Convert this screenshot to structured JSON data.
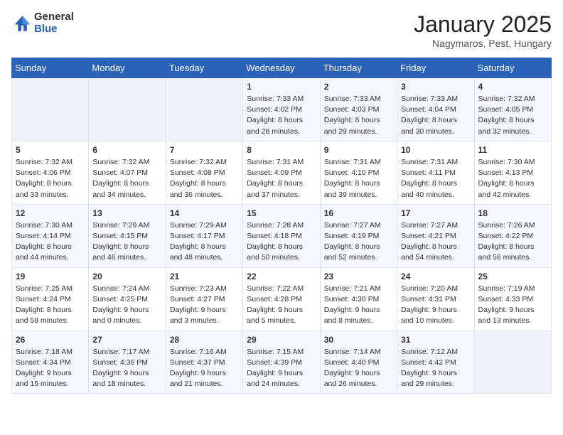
{
  "logo": {
    "general": "General",
    "blue": "Blue"
  },
  "title": "January 2025",
  "location": "Nagymaros, Pest, Hungary",
  "days_of_week": [
    "Sunday",
    "Monday",
    "Tuesday",
    "Wednesday",
    "Thursday",
    "Friday",
    "Saturday"
  ],
  "weeks": [
    [
      {
        "day": "",
        "info": ""
      },
      {
        "day": "",
        "info": ""
      },
      {
        "day": "",
        "info": ""
      },
      {
        "day": "1",
        "info": "Sunrise: 7:33 AM\nSunset: 4:02 PM\nDaylight: 8 hours and 28 minutes."
      },
      {
        "day": "2",
        "info": "Sunrise: 7:33 AM\nSunset: 4:03 PM\nDaylight: 8 hours and 29 minutes."
      },
      {
        "day": "3",
        "info": "Sunrise: 7:33 AM\nSunset: 4:04 PM\nDaylight: 8 hours and 30 minutes."
      },
      {
        "day": "4",
        "info": "Sunrise: 7:32 AM\nSunset: 4:05 PM\nDaylight: 8 hours and 32 minutes."
      }
    ],
    [
      {
        "day": "5",
        "info": "Sunrise: 7:32 AM\nSunset: 4:06 PM\nDaylight: 8 hours and 33 minutes."
      },
      {
        "day": "6",
        "info": "Sunrise: 7:32 AM\nSunset: 4:07 PM\nDaylight: 8 hours and 34 minutes."
      },
      {
        "day": "7",
        "info": "Sunrise: 7:32 AM\nSunset: 4:08 PM\nDaylight: 8 hours and 36 minutes."
      },
      {
        "day": "8",
        "info": "Sunrise: 7:31 AM\nSunset: 4:09 PM\nDaylight: 8 hours and 37 minutes."
      },
      {
        "day": "9",
        "info": "Sunrise: 7:31 AM\nSunset: 4:10 PM\nDaylight: 8 hours and 39 minutes."
      },
      {
        "day": "10",
        "info": "Sunrise: 7:31 AM\nSunset: 4:11 PM\nDaylight: 8 hours and 40 minutes."
      },
      {
        "day": "11",
        "info": "Sunrise: 7:30 AM\nSunset: 4:13 PM\nDaylight: 8 hours and 42 minutes."
      }
    ],
    [
      {
        "day": "12",
        "info": "Sunrise: 7:30 AM\nSunset: 4:14 PM\nDaylight: 8 hours and 44 minutes."
      },
      {
        "day": "13",
        "info": "Sunrise: 7:29 AM\nSunset: 4:15 PM\nDaylight: 8 hours and 46 minutes."
      },
      {
        "day": "14",
        "info": "Sunrise: 7:29 AM\nSunset: 4:17 PM\nDaylight: 8 hours and 48 minutes."
      },
      {
        "day": "15",
        "info": "Sunrise: 7:28 AM\nSunset: 4:18 PM\nDaylight: 8 hours and 50 minutes."
      },
      {
        "day": "16",
        "info": "Sunrise: 7:27 AM\nSunset: 4:19 PM\nDaylight: 8 hours and 52 minutes."
      },
      {
        "day": "17",
        "info": "Sunrise: 7:27 AM\nSunset: 4:21 PM\nDaylight: 8 hours and 54 minutes."
      },
      {
        "day": "18",
        "info": "Sunrise: 7:26 AM\nSunset: 4:22 PM\nDaylight: 8 hours and 56 minutes."
      }
    ],
    [
      {
        "day": "19",
        "info": "Sunrise: 7:25 AM\nSunset: 4:24 PM\nDaylight: 8 hours and 58 minutes."
      },
      {
        "day": "20",
        "info": "Sunrise: 7:24 AM\nSunset: 4:25 PM\nDaylight: 9 hours and 0 minutes."
      },
      {
        "day": "21",
        "info": "Sunrise: 7:23 AM\nSunset: 4:27 PM\nDaylight: 9 hours and 3 minutes."
      },
      {
        "day": "22",
        "info": "Sunrise: 7:22 AM\nSunset: 4:28 PM\nDaylight: 9 hours and 5 minutes."
      },
      {
        "day": "23",
        "info": "Sunrise: 7:21 AM\nSunset: 4:30 PM\nDaylight: 9 hours and 8 minutes."
      },
      {
        "day": "24",
        "info": "Sunrise: 7:20 AM\nSunset: 4:31 PM\nDaylight: 9 hours and 10 minutes."
      },
      {
        "day": "25",
        "info": "Sunrise: 7:19 AM\nSunset: 4:33 PM\nDaylight: 9 hours and 13 minutes."
      }
    ],
    [
      {
        "day": "26",
        "info": "Sunrise: 7:18 AM\nSunset: 4:34 PM\nDaylight: 9 hours and 15 minutes."
      },
      {
        "day": "27",
        "info": "Sunrise: 7:17 AM\nSunset: 4:36 PM\nDaylight: 9 hours and 18 minutes."
      },
      {
        "day": "28",
        "info": "Sunrise: 7:16 AM\nSunset: 4:37 PM\nDaylight: 9 hours and 21 minutes."
      },
      {
        "day": "29",
        "info": "Sunrise: 7:15 AM\nSunset: 4:39 PM\nDaylight: 9 hours and 24 minutes."
      },
      {
        "day": "30",
        "info": "Sunrise: 7:14 AM\nSunset: 4:40 PM\nDaylight: 9 hours and 26 minutes."
      },
      {
        "day": "31",
        "info": "Sunrise: 7:12 AM\nSunset: 4:42 PM\nDaylight: 9 hours and 29 minutes."
      },
      {
        "day": "",
        "info": ""
      }
    ]
  ]
}
